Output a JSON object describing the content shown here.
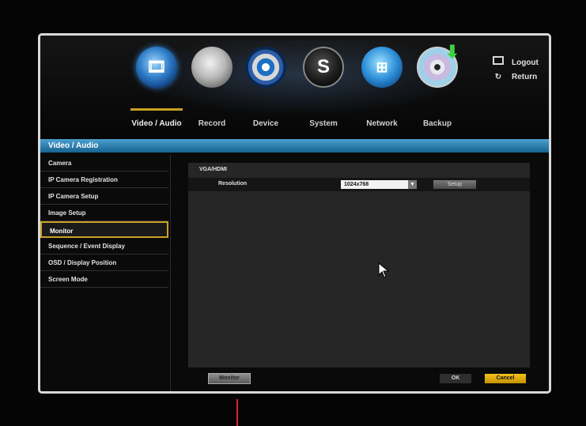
{
  "top_menu": [
    {
      "label": "Video / Audio",
      "icon": "video-audio-icon",
      "active": true
    },
    {
      "label": "Record",
      "icon": "record-icon",
      "active": false
    },
    {
      "label": "Device",
      "icon": "device-icon",
      "active": false
    },
    {
      "label": "System",
      "icon": "system-icon",
      "active": false
    },
    {
      "label": "Network",
      "icon": "network-icon",
      "active": false
    },
    {
      "label": "Backup",
      "icon": "backup-icon",
      "active": false
    }
  ],
  "top_links": {
    "logout": "Logout",
    "return": "Return"
  },
  "section_title": "Video / Audio",
  "sidebar": {
    "items": [
      {
        "label": "Camera"
      },
      {
        "label": "IP Camera Registration"
      },
      {
        "label": "IP Camera Setup"
      },
      {
        "label": "Image Setup"
      },
      {
        "label": "Monitor"
      },
      {
        "label": "Sequence / Event Display"
      },
      {
        "label": "OSD / Display Position"
      },
      {
        "label": "Screen Mode"
      }
    ],
    "active_index": 4
  },
  "content": {
    "group_title": "VGA/HDMI",
    "resolution_label": "Resolution",
    "resolution_value": "1024x768",
    "setup_label": "Setup"
  },
  "buttons": {
    "monitor": "Monitor",
    "ok": "OK",
    "cancel": "Cancel"
  },
  "colors": {
    "accent": "#c9a228",
    "section_bar": "#2a7fb0",
    "cancel": "#e8b010"
  }
}
